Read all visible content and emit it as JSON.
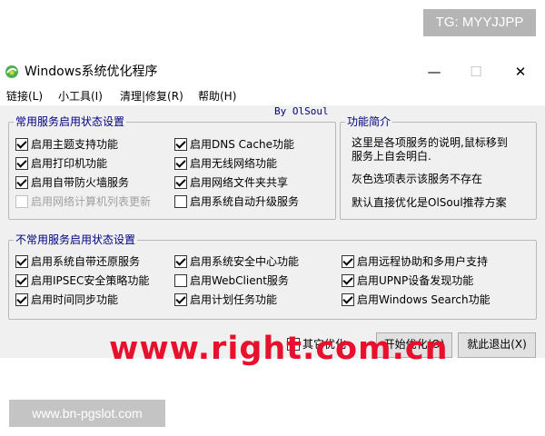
{
  "overlay": {
    "tg_label": "TG: MYYJJPP",
    "site_label": "www.bn-pgslot.com",
    "watermark": "www.right.com.cn"
  },
  "window": {
    "title": "Windows系统优化程序",
    "controls": {
      "minimize": "—",
      "maximize": "☐",
      "close": "✕"
    }
  },
  "menubar": [
    "链接(L)",
    "小工具(I)",
    "清理|修复(R)",
    "帮助(H)"
  ],
  "byline": "By OlSoul",
  "common_group": {
    "legend": "常用服务启用状态设置",
    "items": [
      {
        "label": "启用主题支持功能",
        "checked": true,
        "disabled": false
      },
      {
        "label": "启用打印机功能",
        "checked": true,
        "disabled": false
      },
      {
        "label": "启用自带防火墙服务",
        "checked": true,
        "disabled": false
      },
      {
        "label": "启用网络计算机列表更新",
        "checked": false,
        "disabled": true
      },
      {
        "label": "启用DNS Cache功能",
        "checked": true,
        "disabled": false
      },
      {
        "label": "启用无线网络功能",
        "checked": true,
        "disabled": false
      },
      {
        "label": "启用网络文件夹共享",
        "checked": true,
        "disabled": false
      },
      {
        "label": "启用系统自动升级服务",
        "checked": false,
        "disabled": false
      }
    ]
  },
  "info_group": {
    "legend": "功能简介",
    "line1": "这里是各项服务的说明,鼠标移到",
    "line2": "服务上自会明白.",
    "line3": "灰色选项表示该服务不存在",
    "line4": "默认直接优化是OlSoul推荐方案"
  },
  "uncommon_group": {
    "legend": "不常用服务启用状态设置",
    "items": [
      {
        "label": "启用系统自带还原服务",
        "checked": true
      },
      {
        "label": "启用IPSEC安全策略功能",
        "checked": true
      },
      {
        "label": "启用时间同步功能",
        "checked": true
      },
      {
        "label": "启用系统安全中心功能",
        "checked": true
      },
      {
        "label": "启用WebClient服务",
        "checked": false
      },
      {
        "label": "启用计划任务功能",
        "checked": true
      },
      {
        "label": "启用远程协助和多用户支持",
        "checked": true
      },
      {
        "label": "启用UPNP设备发现功能",
        "checked": true
      },
      {
        "label": "启用Windows Search功能",
        "checked": true
      }
    ]
  },
  "footer": {
    "other_option": "其它优化",
    "optimize_button": "开始优化(O)",
    "exit_button": "就此退出(X)"
  }
}
